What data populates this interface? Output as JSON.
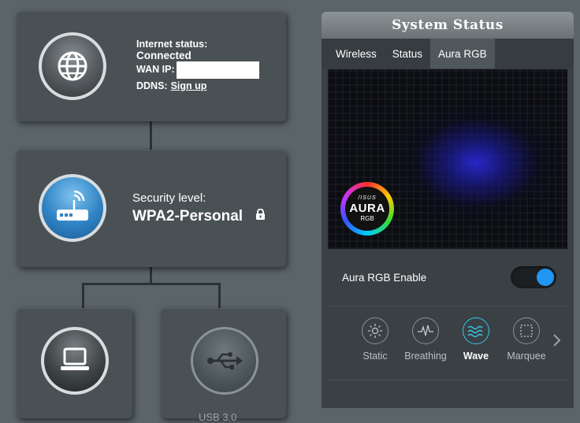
{
  "internet": {
    "status_label": "Internet status:",
    "status_value": "Connected",
    "wan_ip_label": "WAN IP:",
    "ddns_label": "DDNS:",
    "ddns_link": "Sign up"
  },
  "security": {
    "label": "Security level:",
    "value": "WPA2-Personal"
  },
  "usb": {
    "caption": "USB 3.0"
  },
  "panel": {
    "title": "System Status",
    "tabs": [
      {
        "label": "Wireless"
      },
      {
        "label": "Status"
      },
      {
        "label": "Aura RGB"
      }
    ],
    "aura_badge": {
      "brand": "/ISUS",
      "name": "AURA",
      "sub": "RGB"
    },
    "enable_label": "Aura RGB Enable",
    "enable_on": true,
    "modes": [
      {
        "label": "Static",
        "icon": "sun-icon"
      },
      {
        "label": "Breathing",
        "icon": "pulse-icon"
      },
      {
        "label": "Wave",
        "icon": "wave-icon"
      },
      {
        "label": "Marquee",
        "icon": "marquee-icon"
      }
    ],
    "selected_mode": "Wave",
    "accent_color": "#2196f3"
  }
}
